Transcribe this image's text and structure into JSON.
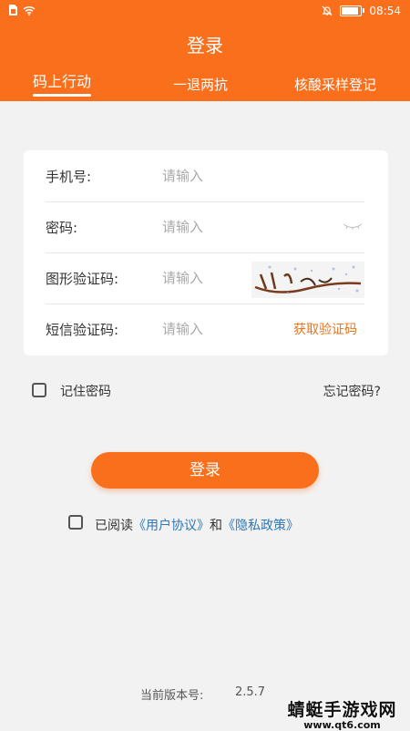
{
  "status_bar": {
    "time": "08:54",
    "battery_level": 0.95
  },
  "header": {
    "title": "登录",
    "tabs": [
      {
        "label": "码上行动",
        "active": true
      },
      {
        "label": "一退两抗",
        "active": false
      },
      {
        "label": "核酸采样登记",
        "active": false
      }
    ]
  },
  "form": {
    "phone": {
      "label": "手机号:",
      "placeholder": "请输入"
    },
    "password": {
      "label": "密码:",
      "placeholder": "请输入"
    },
    "captcha": {
      "label": "图形验证码:",
      "placeholder": "请输入"
    },
    "sms": {
      "label": "短信验证码:",
      "placeholder": "请输入",
      "button": "获取验证码"
    }
  },
  "remember": {
    "label": "记住密码",
    "checked": false
  },
  "forgot_password": "忘记密码?",
  "login_button": "登录",
  "agreement": {
    "checked": false,
    "prefix": "已阅读",
    "user_agreement": "《用户协议》",
    "conjunction": "和",
    "privacy_policy": "《隐私政策》"
  },
  "version": {
    "label": "当前版本号:",
    "value": "2.5.7"
  },
  "watermark": {
    "title": "蜻蜓手游戏网",
    "url": "www.qt6.com"
  },
  "colors": {
    "brand": "#f96f1c",
    "link": "#2f78b7",
    "sms_button": "#e8741e"
  }
}
